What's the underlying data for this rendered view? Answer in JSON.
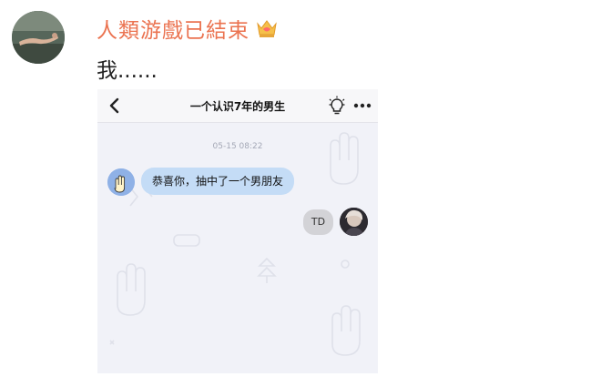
{
  "post": {
    "username": "人類游戲已結束",
    "text": "我......"
  },
  "chat": {
    "title": "一个认识7年的男生",
    "timestamp": "05-15 08:22",
    "messages": [
      {
        "side": "left",
        "text": "恭喜你，抽中了一个男朋友"
      },
      {
        "side": "right",
        "text": "TD"
      }
    ]
  },
  "colors": {
    "username": "#eb7350",
    "incoming_bubble": "#c4dcf6",
    "outgoing_bubble": "#d3d3d7",
    "chat_background": "#f1f2f8"
  }
}
